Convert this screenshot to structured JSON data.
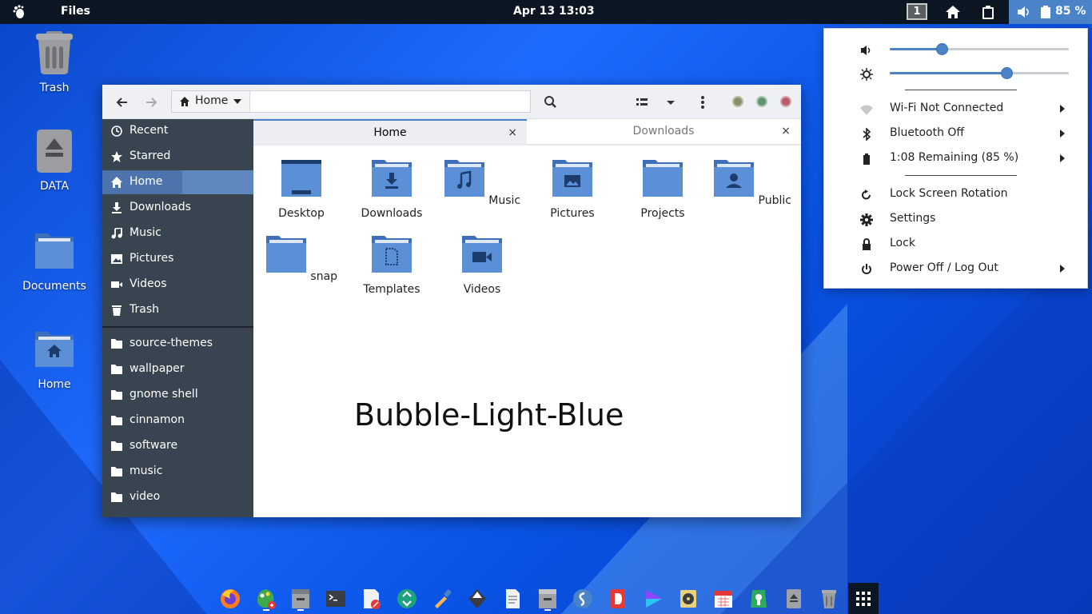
{
  "topbar": {
    "app_name": "Files",
    "clock": "Apr 13  13:03",
    "workspace": "1",
    "battery_percent": "85 %"
  },
  "desktop": {
    "icons": [
      {
        "label": "Trash",
        "icon": "trash-icon"
      },
      {
        "label": "DATA",
        "icon": "drive-icon"
      },
      {
        "label": "Documents",
        "icon": "folder-icon"
      },
      {
        "label": "Home",
        "icon": "home-folder-icon"
      }
    ],
    "watermark": "Bubble-Light-Blue"
  },
  "window": {
    "path": "Home",
    "sidebar": {
      "places": [
        {
          "label": "Recent",
          "icon": "clock-icon"
        },
        {
          "label": "Starred",
          "icon": "star-icon"
        },
        {
          "label": "Home",
          "icon": "home-icon"
        },
        {
          "label": "Downloads",
          "icon": "download-icon"
        },
        {
          "label": "Music",
          "icon": "music-icon"
        },
        {
          "label": "Pictures",
          "icon": "picture-icon"
        },
        {
          "label": "Videos",
          "icon": "video-icon"
        },
        {
          "label": "Trash",
          "icon": "trash-icon"
        }
      ],
      "bookmarks": [
        {
          "label": "source-themes",
          "icon": "folder-icon"
        },
        {
          "label": "wallpaper",
          "icon": "folder-icon"
        },
        {
          "label": "gnome shell",
          "icon": "folder-icon"
        },
        {
          "label": "cinnamon",
          "icon": "folder-icon"
        },
        {
          "label": "software",
          "icon": "folder-icon"
        },
        {
          "label": "music",
          "icon": "folder-icon"
        },
        {
          "label": "video",
          "icon": "folder-icon"
        }
      ]
    },
    "tabs": [
      {
        "label": "Home",
        "close": "×"
      },
      {
        "label": "Downloads",
        "close": "×"
      }
    ],
    "files": [
      {
        "label": "Desktop",
        "icon": "desktop-folder-icon"
      },
      {
        "label": "Downloads",
        "icon": "download-folder-icon"
      },
      {
        "label": "Music",
        "icon": "music-folder-icon"
      },
      {
        "label": "Pictures",
        "icon": "pictures-folder-icon"
      },
      {
        "label": "Projects",
        "icon": "folder-icon"
      },
      {
        "label": "Public",
        "icon": "public-folder-icon"
      },
      {
        "label": "snap",
        "icon": "folder-icon"
      },
      {
        "label": "Templates",
        "icon": "templates-folder-icon"
      },
      {
        "label": "Videos",
        "icon": "videos-folder-icon"
      }
    ]
  },
  "system_menu": {
    "volume_level": 0.29,
    "brightness_level": 0.65,
    "items": {
      "wifi": "Wi-Fi Not Connected",
      "bluetooth": "Bluetooth Off",
      "battery": "1:08 Remaining (85 %)",
      "rotation": "Lock Screen Rotation",
      "settings": "Settings",
      "lock": "Lock",
      "power": "Power Off / Log Out"
    }
  },
  "dock": {
    "apps": [
      "firefox-icon",
      "color-picker-icon",
      "files-icon",
      "terminal-icon",
      "text-editor-icon",
      "recycle-icon",
      "eyedropper-icon",
      "inkscape-icon",
      "document-icon",
      "archive-icon",
      "simplenote-icon",
      "deadbeef-icon",
      "media-player-icon",
      "rhythmbox-icon",
      "calendar-icon",
      "software-icon",
      "usb-drive-icon",
      "trash-icon",
      "app-grid-icon"
    ]
  },
  "colors": {
    "accent": "#4a83c8",
    "sidebar_bg": "#394451",
    "folder_blue": "#5b8fd6",
    "topbar": "#0c1622"
  }
}
